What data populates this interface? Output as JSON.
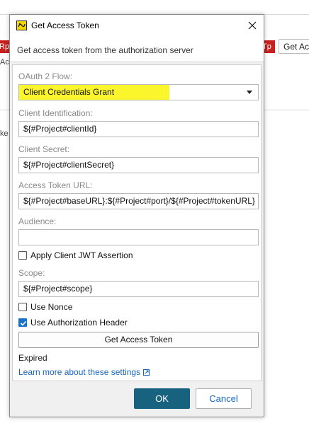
{
  "background": {
    "left_fragment_red": "Rp",
    "left_fragment_text": "Ac",
    "left_fragment_text2": "ke",
    "right_fragment_red": "Tp",
    "right_button_label": "Get Ac"
  },
  "dialog": {
    "title": "Get Access Token",
    "header": "Get access token from the authorization server",
    "oauth_flow": {
      "label": "OAuth 2 Flow:",
      "value": "Client Credentials Grant"
    },
    "client_identification": {
      "label": "Client Identification:",
      "value": "${#Project#clientId}"
    },
    "client_secret": {
      "label": "Client Secret:",
      "value": "${#Project#clientSecret}"
    },
    "access_token_url": {
      "label": "Access Token URL:",
      "value": "${#Project#baseURL}:${#Project#port}/${#Project#tokenURL}"
    },
    "audience": {
      "label": "Audience:",
      "value": ""
    },
    "apply_client_jwt": {
      "label": "Apply Client JWT Assertion",
      "checked": false
    },
    "scope": {
      "label": "Scope:",
      "value": "${#Project#scope}"
    },
    "use_nonce": {
      "label": "Use Nonce",
      "checked": false
    },
    "use_auth_header": {
      "label": "Use Authorization Header",
      "checked": true
    },
    "get_token_button": "Get Access Token",
    "status": "Expired",
    "learn_more": "Learn more about these settings",
    "ok_button": "OK",
    "cancel_button": "Cancel"
  },
  "colors": {
    "highlight": "#fbf52c",
    "primary_button": "#17627e",
    "link": "#1565c0",
    "checkbox_checked": "#1a73c9"
  }
}
